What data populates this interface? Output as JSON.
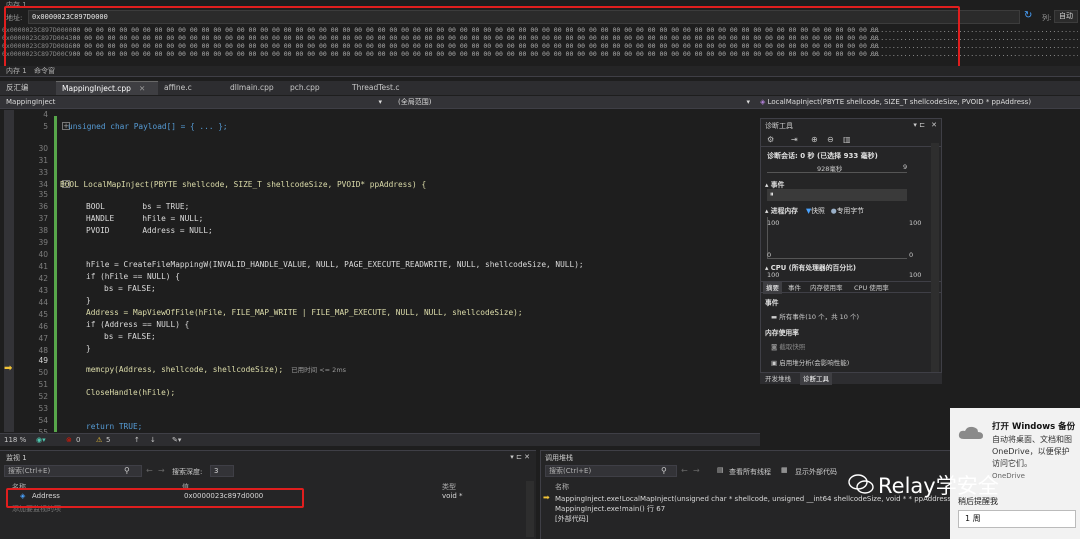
{
  "memory": {
    "title": "内存 1",
    "address_label": "地址:",
    "address_value": "0x0000023C897D0000",
    "column_label": "列:",
    "column_value": "自动",
    "rows": [
      {
        "addr": "0x0000023C897D0000",
        "hex": "00 00 00 00 00 00 00 00 00 00 00 00 00 00 00 00 00 00 00 00 00 00 00 00 00 00 00 00 00 00 00 00 00 00 00 00 00 00 00 00 00 00 00 00 00 00 00 00 00 00 00 00 00 00 00 00 00 00 00 00 00 00 00 00 00 00 00 00 00",
        "text": "..............................................................."
      },
      {
        "addr": "0x0000023C897D0043",
        "hex": "00 00 00 00 00 00 00 00 00 00 00 00 00 00 00 00 00 00 00 00 00 00 00 00 00 00 00 00 00 00 00 00 00 00 00 00 00 00 00 00 00 00 00 00 00 00 00 00 00 00 00 00 00 00 00 00 00 00 00 00 00 00 00 00 00 00 00 00 00",
        "text": "..............................................................."
      },
      {
        "addr": "0x0000023C897D0086",
        "hex": "00 00 00 00 00 00 00 00 00 00 00 00 00 00 00 00 00 00 00 00 00 00 00 00 00 00 00 00 00 00 00 00 00 00 00 00 00 00 00 00 00 00 00 00 00 00 00 00 00 00 00 00 00 00 00 00 00 00 00 00 00 00 00 00 00 00 00 00 00",
        "text": "..............................................................."
      },
      {
        "addr": "0x0000023C897D00C9",
        "hex": "00 00 00 00 00 00 00 00 00 00 00 00 00 00 00 00 00 00 00 00 00 00 00 00 00 00 00 00 00 00 00 00 00 00 00 00 00 00 00 00 00 00 00 00 00 00 00 00 00 00 00 00 00 00 00 00 00 00 00 00 00 00 00 00 00 00 00 00 00",
        "text": "..............................................................."
      }
    ]
  },
  "lower_tabs": [
    "内存 1",
    "命令窗"
  ],
  "doc_tabs": [
    {
      "label": "反汇编"
    },
    {
      "label": "MappingInject.cpp"
    },
    {
      "label": "affine.c"
    },
    {
      "label": "dllmain.cpp"
    },
    {
      "label": "pch.cpp"
    },
    {
      "label": "ThreadTest.c"
    }
  ],
  "nav": {
    "project": "MappingInject",
    "scope": "(全局范围)",
    "function": "LocalMapInject(PBYTE shellcode, SIZE_T shellcodeSize, PVOID * ppAddress)"
  },
  "line_numbers": [
    "4",
    "5",
    "30",
    "31",
    "33",
    "34",
    "35",
    "36",
    "37",
    "38",
    "39",
    "40",
    "41",
    "42",
    "43",
    "44",
    "45",
    "46",
    "47",
    "48",
    "49",
    "50",
    "51",
    "52",
    "53",
    "54",
    "55"
  ],
  "code": {
    "l5": "unsigned char Payload[] = { ... };",
    "l34": "BOOL LocalMapInject(PBYTE shellcode, SIZE_T shellcodeSize, PVOID* ppAddress) {",
    "l36": "BOOL        bs = TRUE;",
    "l37": "HANDLE      hFile = NULL;",
    "l38": "PVOID       Address = NULL;",
    "l41": "hFile = CreateFileMappingW(INVALID_HANDLE_VALUE, NULL, PAGE_EXECUTE_READWRITE, NULL, shellcodeSize, NULL);",
    "l42": "if (hFile == NULL) {",
    "l43": "bs = FALSE;",
    "l44": "}",
    "l45": "Address = MapViewOfFile(hFile, FILE_MAP_WRITE | FILE_MAP_EXECUTE, NULL, NULL, shellcodeSize);",
    "l46": "if (Address == NULL) {",
    "l47": "bs = FALSE;",
    "l48": "}",
    "l50": "memcpy(Address, shellcode, shellcodeSize);",
    "l50_hint": "已用时间 <= 2ms",
    "l52": "CloseHandle(hFile);",
    "l55": "return TRUE;"
  },
  "diag": {
    "title": "诊断工具",
    "session": "诊断会话: 0 秒 (已选择 933 毫秒)",
    "tick": "928毫秒",
    "tick_right": "9",
    "events": "事件",
    "process_memory": "进程内存",
    "legend_snapshot": "快照",
    "legend_private": "专用字节",
    "mem_max_left": "100",
    "mem_min_left": "0",
    "mem_max_right": "100",
    "mem_min_right": "0",
    "cpu": "CPU (所有处理器的百分比)",
    "tabs": [
      "摘要",
      "事件",
      "内存使用率",
      "CPU 使用率"
    ],
    "events_header": "事件",
    "all_events": "所有事件(10 个，共 10 个)",
    "memory_usage": "内存使用率",
    "take_snapshot": "截取快照",
    "heap_profile": "启用堆分析(会影响性能)",
    "bottom_tabs": [
      "开发堆栈",
      "诊断工具"
    ]
  },
  "edit_status": {
    "zoom": "118 %",
    "errors": "0",
    "warnings": "5"
  },
  "watch": {
    "title": "监视 1",
    "search_placeholder": "搜索(Ctrl+E)",
    "depth_label": "搜索深度:",
    "depth_value": "3",
    "col_name": "名称",
    "col_value": "值",
    "col_type": "类型",
    "row_name": "Address",
    "row_value": "0x0000023c897d0000",
    "row_type": "void *",
    "add_item": "添加要监视的项"
  },
  "callstack": {
    "title": "调用堆栈",
    "search_placeholder": "搜索(Ctrl+E)",
    "view_all_threads": "查看所有线程",
    "show_external": "显示外部代码",
    "col_name": "名称",
    "frames": [
      "MappingInject.exe!LocalMapInject(unsigned char * shellcode, unsigned __int64 shellcodeSize, void * * ppAddress) 行 50",
      "MappingInject.exe!main() 行 67",
      "[外部代码]"
    ]
  },
  "toast": {
    "title": "打开 Windows 备份",
    "line1": "自动将桌面、文档和图",
    "line2": "OneDrive，以便保护",
    "line3": "访问它们。",
    "source": "OneDrive",
    "remind": "稍后提醒我",
    "select_value": "1 周"
  },
  "watermark": "Relay学安全",
  "colors": {
    "highlight_box": "#e01e1e",
    "accent": "#007acc",
    "green_change_bar": "#57a64a"
  }
}
